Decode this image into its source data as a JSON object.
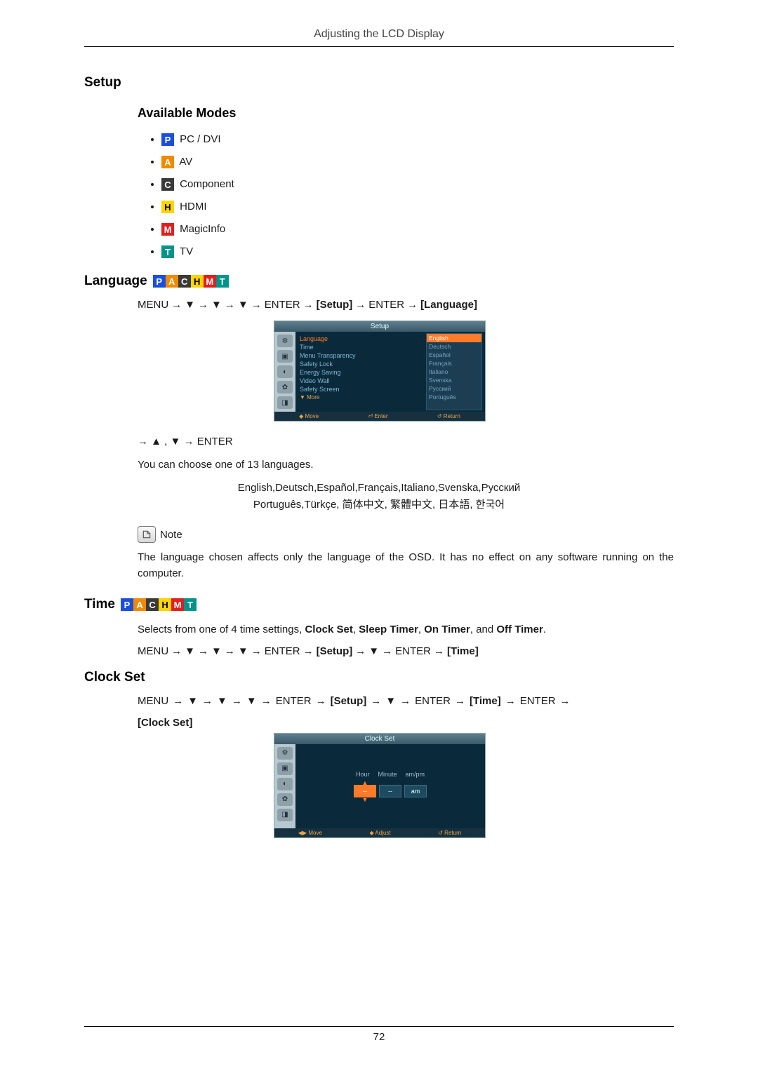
{
  "header": {
    "title": "Adjusting the LCD Display"
  },
  "setup_heading": "Setup",
  "available_modes_heading": "Available Modes",
  "modes": {
    "pc": {
      "letter": "P",
      "label": "PC / DVI"
    },
    "av": {
      "letter": "A",
      "label": "AV"
    },
    "component": {
      "letter": "C",
      "label": "Component"
    },
    "hdmi": {
      "letter": "H",
      "label": "HDMI"
    },
    "magicinfo": {
      "letter": "M",
      "label": "MagicInfo"
    },
    "tv": {
      "letter": "T",
      "label": "TV"
    }
  },
  "language": {
    "heading": "Language",
    "nav": {
      "menu": "MENU",
      "arrow": "→",
      "down": "▼",
      "up": "▲",
      "enter": "ENTER",
      "setup": "[Setup]",
      "language": "[Language]"
    },
    "post_nav": "→ ▲ , ▼ → ENTER",
    "desc": "You can choose one of 13 languages.",
    "list_line1": "English,Deutsch,Español,Français,Italiano,Svenska,Русский",
    "list_line2": "Português,Türkçe, 简体中文,  繁體中文, 日本語, 한국어",
    "note_label": "Note",
    "note_text": "The language chosen affects only the language of the OSD. It has no effect on any software running on the computer."
  },
  "osd_setup": {
    "title": "Setup",
    "menu_items": [
      "Language",
      "Time",
      "Menu Transparency",
      "Safety Lock",
      "Energy Saving",
      "Video Wall",
      "Safety Screen"
    ],
    "more": "▼ More",
    "languages": [
      "English",
      "Deutsch",
      "Español",
      "Français",
      "Italiano",
      "Svenska",
      "Русский",
      "Português"
    ],
    "footer": {
      "move": "◆ Move",
      "enter": "⏎ Enter",
      "return": "↺ Return"
    }
  },
  "time": {
    "heading": "Time",
    "desc_a": "Selects from one of 4 time settings, ",
    "opt1": "Clock Set",
    "opt2": "Sleep Timer",
    "opt3": "On Timer",
    "opt4": "Off Timer",
    "desc_sep": ", ",
    "desc_and": " and ",
    "desc_end": ".",
    "nav": {
      "menu": "MENU",
      "arrow": "→",
      "down": "▼",
      "enter": "ENTER",
      "setup": "[Setup]",
      "time": "[Time]"
    }
  },
  "clockset": {
    "heading": "Clock Set",
    "nav": {
      "menu": "MENU",
      "arrow": "→",
      "down": "▼",
      "enter": "ENTER",
      "setup": "[Setup]",
      "time": "[Time]",
      "clockset": "[Clock Set]"
    }
  },
  "osd_clock": {
    "title": "Clock Set",
    "labels": {
      "hour": "Hour",
      "minute": "Minute",
      "ampm": "am/pm"
    },
    "values": {
      "hour": "--",
      "minute": "--",
      "ampm": "am"
    },
    "footer": {
      "move": "◀▶ Move",
      "adjust": "◆ Adjust",
      "return": "↺ Return"
    }
  },
  "page_number": "72"
}
